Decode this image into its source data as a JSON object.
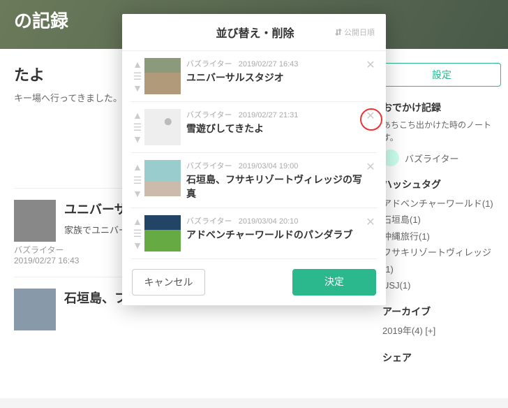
{
  "bg": {
    "header_title": "の記録",
    "sub_title": "たよ",
    "sub_text": "キー場へ行ってきました。娘",
    "posts": [
      {
        "title": "ユニバーサルス",
        "text": "家族でユニバーサルった。また来たい。",
        "author": "バズライター",
        "date": "2019/02/27 16:43"
      },
      {
        "title": "石垣島、フサキ",
        "text": "",
        "author": "",
        "date": ""
      }
    ],
    "side": {
      "set_btn": "設定",
      "h1": "おでかけ記録",
      "desc": "あちこち出かけた時のノートす。",
      "author": "バズライター",
      "h2": "ハッシュタグ",
      "tags": [
        "アドベンチャーワールド(1)",
        "石垣島(1)",
        "沖縄旅行(1)",
        "フサキリゾートヴィレッジ(1)",
        "USJ(1)"
      ],
      "h3": "アーカイブ",
      "arch": "2019年(4) [+]",
      "h4": "シェア"
    }
  },
  "modal": {
    "title": "並び替え・削除",
    "sort_label": "公開日順",
    "cancel": "キャンセル",
    "ok": "決定",
    "items": [
      {
        "author": "バズライター",
        "date": "2019/02/27 16:43",
        "title": "ユニバーサルスタジオ"
      },
      {
        "author": "バズライター",
        "date": "2019/02/27 21:31",
        "title": "雪遊びしてきたよ"
      },
      {
        "author": "バズライター",
        "date": "2019/03/04 19:00",
        "title": "石垣島、フサキリゾートヴィレッジの写真"
      },
      {
        "author": "バズライター",
        "date": "2019/03/04 20:10",
        "title": "アドベンチャーワールドのパンダラブ"
      }
    ]
  }
}
